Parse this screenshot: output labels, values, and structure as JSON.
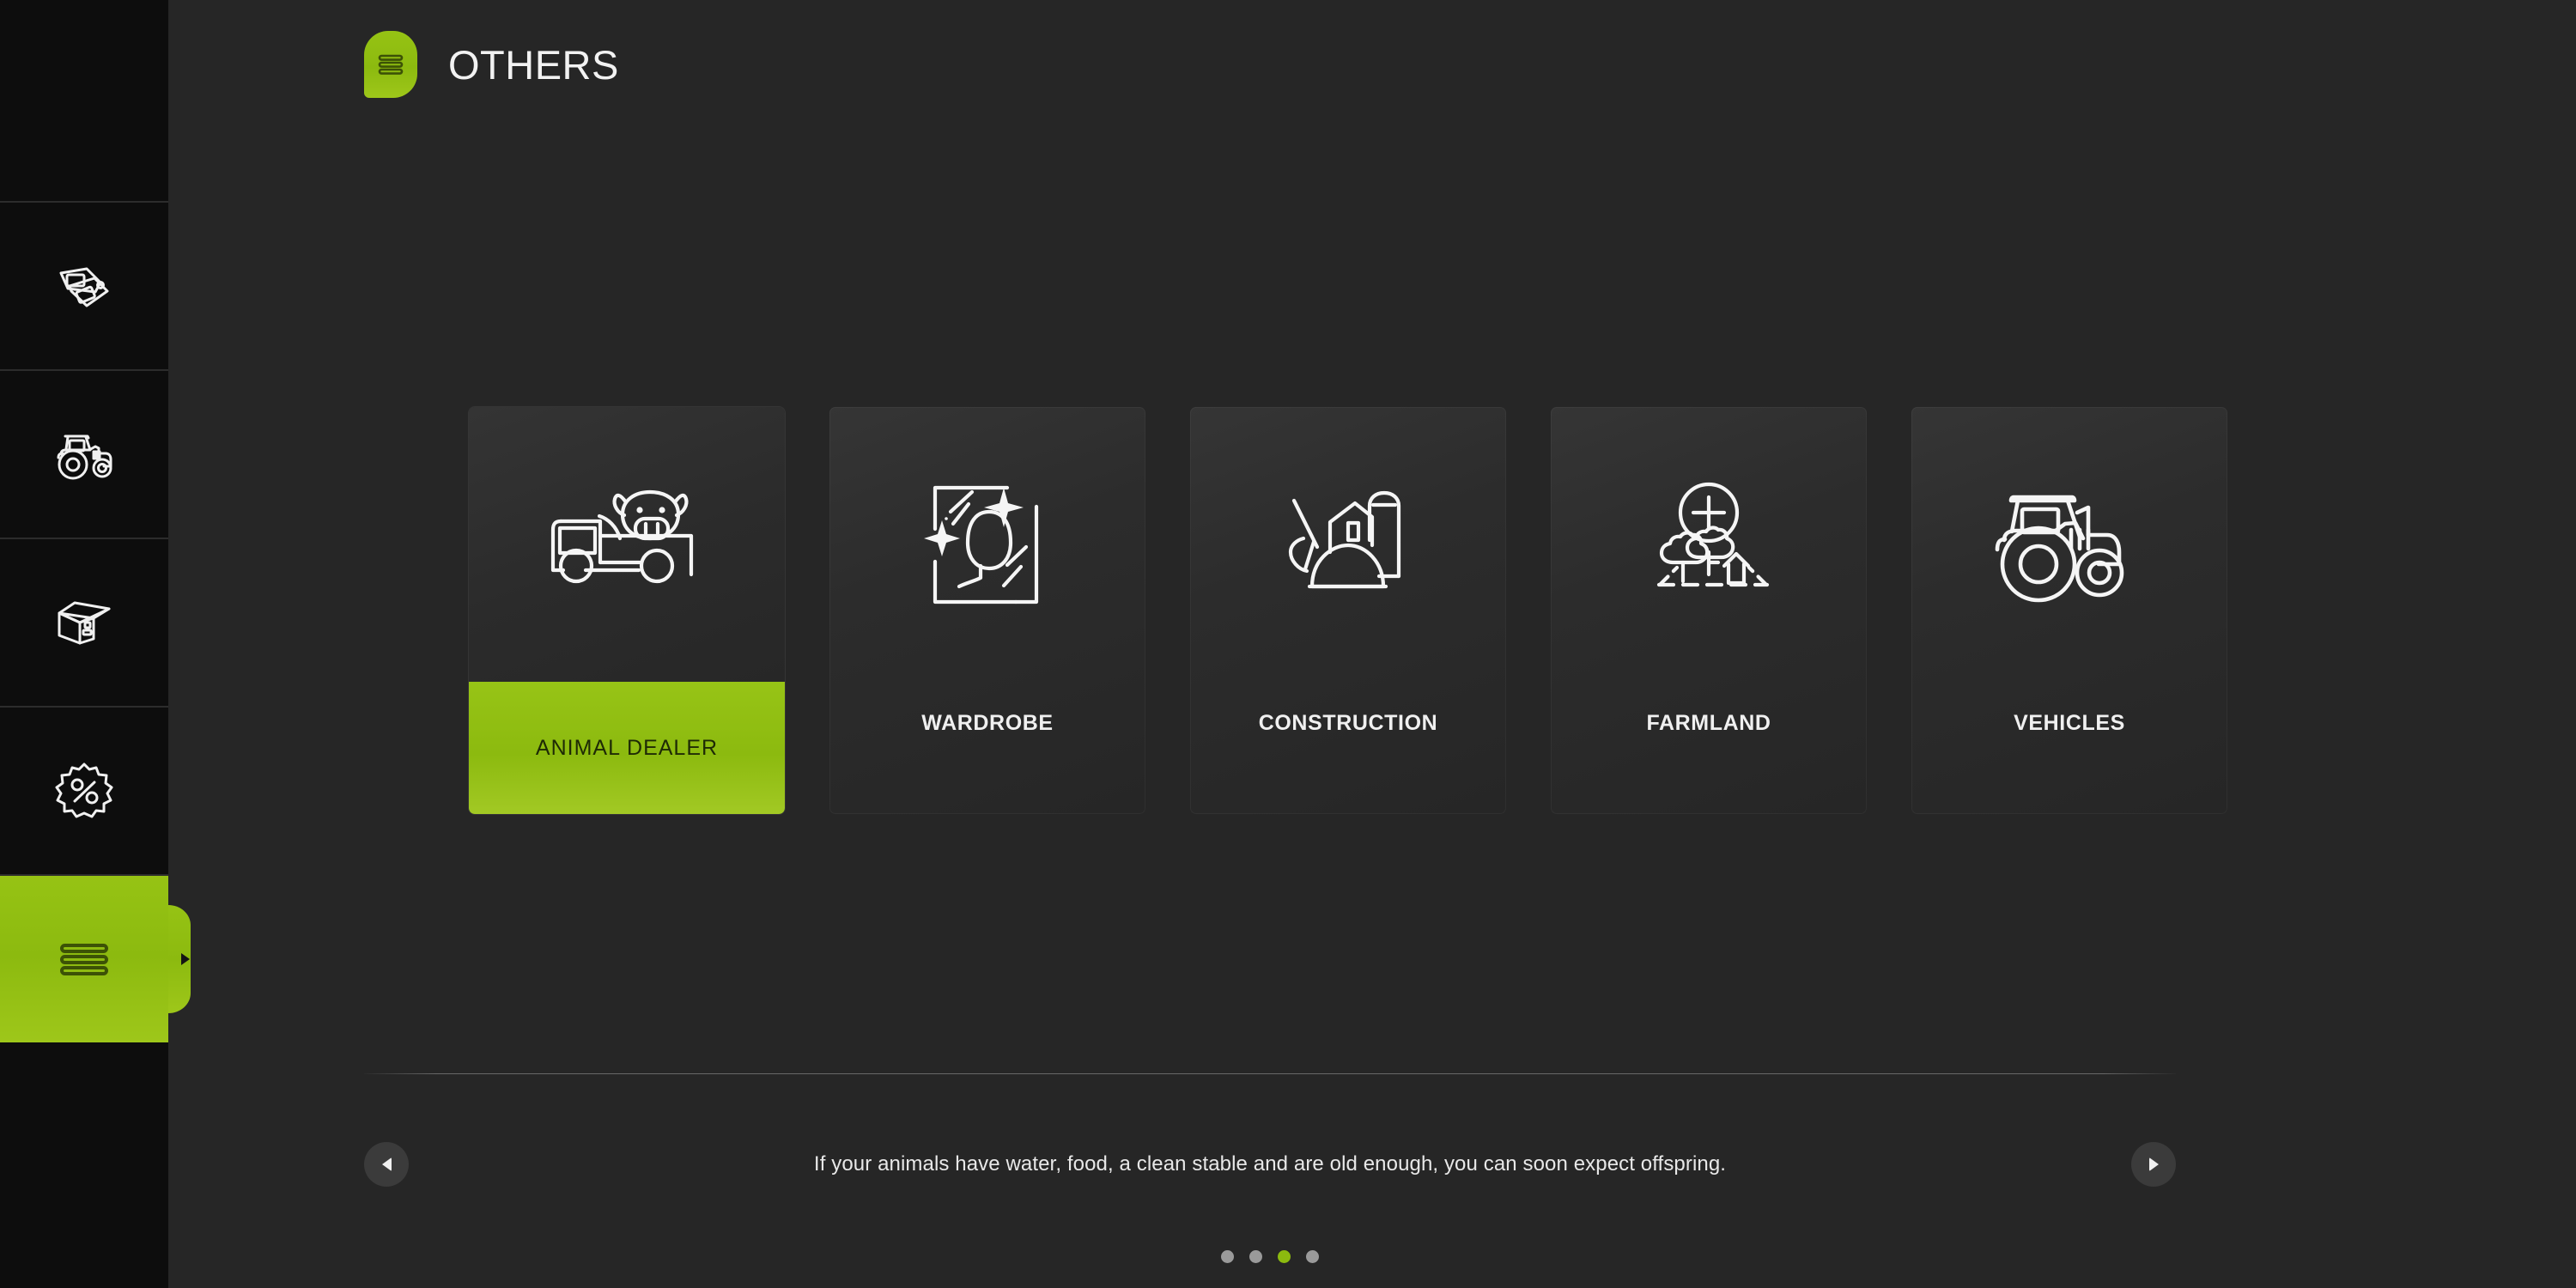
{
  "header": {
    "title": "OTHERS",
    "badge_icon": "menu-lines-icon"
  },
  "sidebar": {
    "items": [
      {
        "name": "prices",
        "icon": "price-tags-icon",
        "active": false
      },
      {
        "name": "vehicles",
        "icon": "tractor-icon",
        "active": false
      },
      {
        "name": "production",
        "icon": "box-icon",
        "active": false
      },
      {
        "name": "finances",
        "icon": "discount-percent-icon",
        "active": false
      },
      {
        "name": "others",
        "icon": "menu-lines-icon",
        "active": true
      }
    ]
  },
  "main": {
    "cards": [
      {
        "label": "ANIMAL DEALER",
        "icon": "truck-pig-icon",
        "selected": true
      },
      {
        "label": "WARDROBE",
        "icon": "mirror-person-icon",
        "selected": false
      },
      {
        "label": "CONSTRUCTION",
        "icon": "barn-silo-shovel-icon",
        "selected": false
      },
      {
        "label": "FARMLAND",
        "icon": "land-plus-trees-icon",
        "selected": false
      },
      {
        "label": "VEHICLES",
        "icon": "tractor-icon",
        "selected": false
      }
    ]
  },
  "tipbar": {
    "prev_label": "◀",
    "next_label": "▶",
    "text": "If your animals have water, food, a clean stable and are old enough, you can soon expect offspring.",
    "dots": [
      {
        "active": false
      },
      {
        "active": false
      },
      {
        "active": true
      },
      {
        "active": false
      }
    ]
  },
  "colors": {
    "accent_green": "#8cba0f",
    "sidebar_bg": "#0d0d0d",
    "main_bg": "#262626",
    "card_bg": "#2c2c2c",
    "text_light": "#f0f0f0",
    "dot_inactive": "#9a9a9a"
  }
}
